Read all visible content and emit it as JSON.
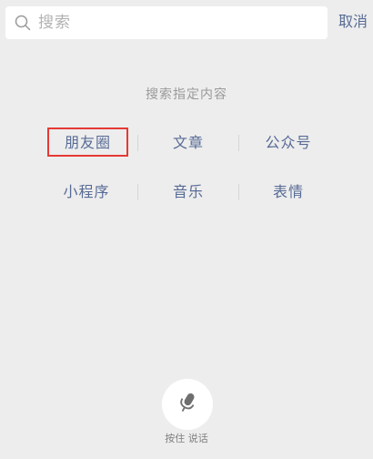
{
  "search": {
    "placeholder": "搜索",
    "cancel_label": "取消"
  },
  "hint": "搜索指定内容",
  "categories": [
    {
      "label": "朋友圈",
      "selected": true
    },
    {
      "label": "文章",
      "selected": false
    },
    {
      "label": "公众号",
      "selected": false
    },
    {
      "label": "小程序",
      "selected": false
    },
    {
      "label": "音乐",
      "selected": false
    },
    {
      "label": "表情",
      "selected": false
    }
  ],
  "voice": {
    "label": "按住 说话",
    "icon": "microphone-icon"
  },
  "colors": {
    "background": "#ededed",
    "link": "#576b95",
    "hint": "#9a9a9a",
    "selection_border": "#e53935"
  }
}
